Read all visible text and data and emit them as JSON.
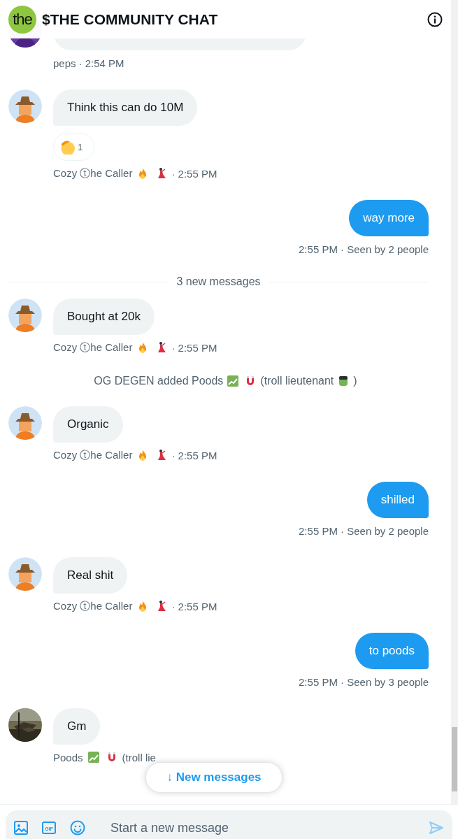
{
  "header": {
    "logo": "the",
    "title": "$THE COMMUNITY CHAT"
  },
  "messages": [
    {
      "kind": "incoming",
      "avatar": {
        "kind": "purple"
      },
      "meta": [
        {
          "text": "peps"
        },
        {
          "text": "· 2:54 PM"
        }
      ]
    },
    {
      "kind": "incoming",
      "avatar": {
        "kind": "cowboy"
      },
      "text": "Think this can do 10M",
      "reactions": [
        {
          "kind": "salute",
          "count": "1"
        }
      ],
      "meta": [
        {
          "text": "Cozy ⓣhe Caller"
        },
        {
          "kind": "fire"
        },
        {
          "kind": "dancer"
        },
        {
          "text": "· 2:55 PM"
        }
      ]
    },
    {
      "kind": "outgoing",
      "text": "way more",
      "meta": "2:55 PM · Seen by 2 people"
    },
    {
      "kind": "divider",
      "text": "3 new messages"
    },
    {
      "kind": "incoming",
      "avatar": {
        "kind": "cowboy"
      },
      "text": "Bought at 20k",
      "meta": [
        {
          "text": "Cozy ⓣhe Caller"
        },
        {
          "kind": "fire"
        },
        {
          "kind": "dancer"
        },
        {
          "text": "· 2:55 PM"
        }
      ]
    },
    {
      "kind": "system",
      "parts": [
        {
          "text": "OG DEGEN added Poods"
        },
        {
          "kind": "chart"
        },
        {
          "kind": "magnet"
        },
        {
          "text": "(troll lieutenant"
        },
        {
          "kind": "zombie"
        },
        {
          "text": ")"
        }
      ]
    },
    {
      "kind": "incoming",
      "avatar": {
        "kind": "cowboy"
      },
      "text": "Organic",
      "meta": [
        {
          "text": "Cozy ⓣhe Caller"
        },
        {
          "kind": "fire"
        },
        {
          "kind": "dancer"
        },
        {
          "text": "· 2:55 PM"
        }
      ]
    },
    {
      "kind": "outgoing",
      "text": "shilled",
      "meta": "2:55 PM · Seen by 2 people"
    },
    {
      "kind": "incoming",
      "avatar": {
        "kind": "cowboy"
      },
      "text": "Real shit",
      "meta": [
        {
          "text": "Cozy ⓣhe Caller"
        },
        {
          "kind": "fire"
        },
        {
          "kind": "dancer"
        },
        {
          "text": "· 2:55 PM"
        }
      ]
    },
    {
      "kind": "outgoing",
      "text": "to poods",
      "meta": "2:55 PM · Seen by 3 people"
    },
    {
      "kind": "incoming",
      "text": "Gm",
      "meta": [
        {
          "text": "Poods"
        },
        {
          "kind": "chart"
        },
        {
          "kind": "magnet"
        },
        {
          "text": "(troll lie"
        }
      ]
    }
  ],
  "new_messages_button": "↓ New messages",
  "composer": {
    "gif_label": "GIF",
    "placeholder": "Start a new message"
  }
}
